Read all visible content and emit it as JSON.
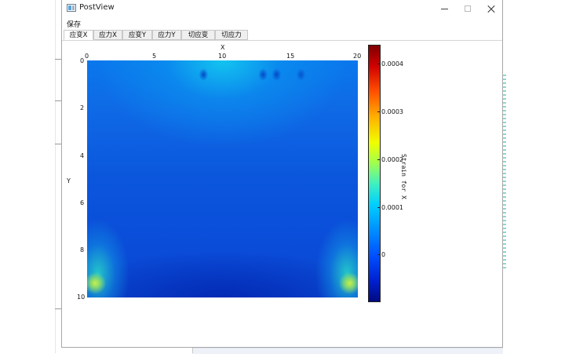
{
  "window": {
    "title": "PostView",
    "controls": {
      "minimize": "",
      "maximize": "",
      "close": ""
    }
  },
  "menu": {
    "items": [
      "保存"
    ]
  },
  "tabs": [
    {
      "label": "应变X",
      "active": true
    },
    {
      "label": "应力X",
      "active": false
    },
    {
      "label": "应变Y",
      "active": false
    },
    {
      "label": "应力Y",
      "active": false
    },
    {
      "label": "切应变",
      "active": false
    },
    {
      "label": "切应力",
      "active": false
    }
  ],
  "chart_data": {
    "type": "heatmap",
    "title": "",
    "xlabel": "X",
    "ylabel": "Y",
    "x_ticks": [
      "0",
      "5",
      "10",
      "15",
      "20"
    ],
    "y_ticks": [
      "0",
      "2",
      "4",
      "6",
      "8",
      "10"
    ],
    "xlim": [
      0,
      20
    ],
    "ylim": [
      0,
      10
    ],
    "x_axis_position": "top",
    "y_axis_inverted": true,
    "colorbar": {
      "label": "Strain for X",
      "ticks": [
        "0.0004",
        "0.0003",
        "0.0002",
        "0.0001",
        "0"
      ],
      "range": [
        -9e-05,
        0.00044
      ],
      "colormap": "jet"
    },
    "field_description_values": {
      "dominant": 2e-05,
      "top_center": 8e-05,
      "bottom_corners": 0.00022
    }
  }
}
